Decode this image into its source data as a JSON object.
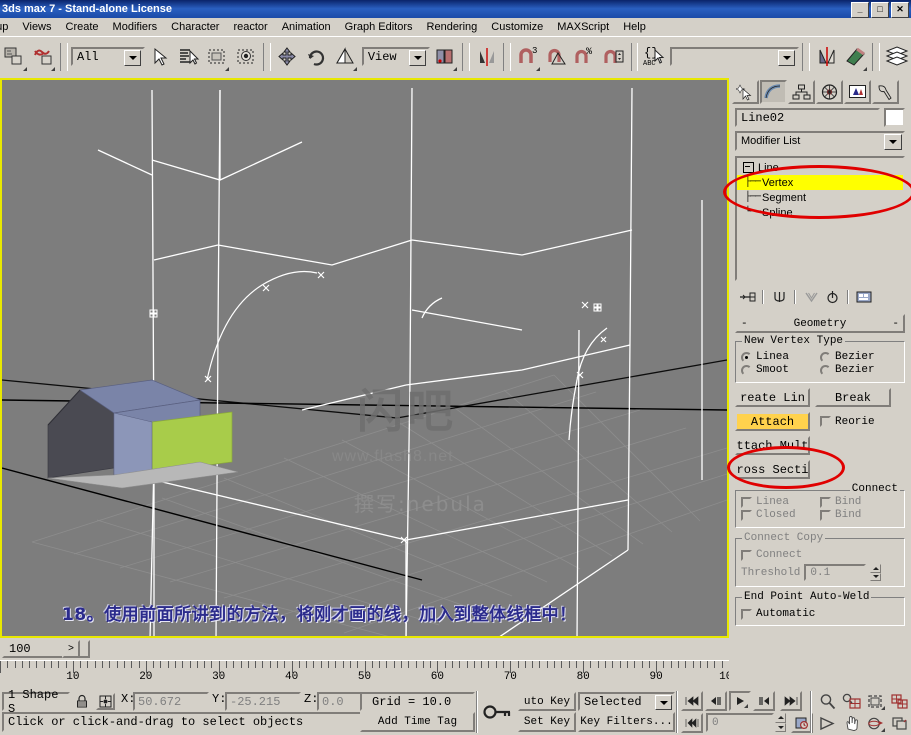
{
  "window": {
    "title": "3ds max 7  - Stand-alone License",
    "minimize": "_",
    "maximize": "□",
    "close": "✕"
  },
  "menu": {
    "items": [
      {
        "label": "oup"
      },
      {
        "label": "Views"
      },
      {
        "label": "Create"
      },
      {
        "label": "Modifiers"
      },
      {
        "label": "Character"
      },
      {
        "label": "reactor"
      },
      {
        "label": "Animation"
      },
      {
        "label": "Graph Editors"
      },
      {
        "label": "Rendering"
      },
      {
        "label": "Customize"
      },
      {
        "label": "MAXScript"
      },
      {
        "label": "Help"
      }
    ]
  },
  "toolbar": {
    "selection_filter": "All",
    "reference_coord": "View",
    "named_selection_set": "",
    "icons": [
      "undo-icon",
      "redo-icon",
      "select-link-icon",
      "unlink-icon",
      "bind-space-warp-icon",
      "select-object-icon",
      "select-by-name-icon",
      "rectangular-region-icon",
      "window-crossing-icon",
      "select-and-move-icon",
      "select-and-rotate-icon",
      "select-and-scale-icon",
      "use-pivot-center-icon",
      "mirror-icon",
      "align-icon",
      "layer-manager-icon",
      "snap-toggle-icon",
      "angle-snap-icon",
      "percent-snap-icon",
      "spinner-snap-icon",
      "named-selection-icon",
      "curve-editor-icon",
      "schematic-view-icon",
      "material-editor-icon",
      "render-scene-icon",
      "render-type-icon",
      "quick-render-icon"
    ]
  },
  "viewport": {
    "annotation": "18。使用前面所讲到的方法，将刚才画的线，加入到整体线框中！",
    "watermark_logo": "闪吧",
    "watermark_url": "www.flash8.net",
    "watermark_author": "撰写:nebula",
    "grid_color": "#8a8a8a",
    "background_color": "#7d7d7d",
    "border_color": "#e8e800"
  },
  "timeline": {
    "frame_field": "100",
    "next_arrow": ">",
    "tick_labels": [
      "10",
      "20",
      "30",
      "40",
      "50",
      "60",
      "70",
      "80",
      "90",
      "100"
    ]
  },
  "command_panel": {
    "tabs": [
      {
        "name": "create-tab",
        "icon": "star-arrow-icon",
        "selected": false
      },
      {
        "name": "modify-tab",
        "icon": "curve-icon",
        "selected": true
      },
      {
        "name": "hierarchy-tab",
        "icon": "hierarchy-icon",
        "selected": false
      },
      {
        "name": "motion-tab",
        "icon": "wheel-icon",
        "selected": false
      },
      {
        "name": "display-tab",
        "icon": "monitor-icon",
        "selected": false
      },
      {
        "name": "utilities-tab",
        "icon": "hammer-icon",
        "selected": false
      }
    ],
    "object_name": "Line02",
    "modifier_list_label": "Modifier List",
    "stack": [
      {
        "label": "Line",
        "type": "base",
        "selected": false
      },
      {
        "label": "Vertex",
        "type": "sub",
        "selected": true
      },
      {
        "label": "Segment",
        "type": "sub",
        "selected": false
      },
      {
        "label": "Spline",
        "type": "sub",
        "selected": false
      }
    ],
    "stack_tools": [
      "pin-stack-icon",
      "show-end-result-icon",
      "make-unique-icon",
      "remove-modifier-icon",
      "configure-sets-icon"
    ],
    "geometry_rollout": {
      "title": "Geometry",
      "collapse": "-",
      "new_vertex_type": {
        "title": "New Vertex Type",
        "options": [
          {
            "label": "Linea",
            "selected": true
          },
          {
            "label": "Bezier",
            "selected": false
          },
          {
            "label": "Smoot",
            "selected": false
          },
          {
            "label": "Bezier",
            "selected": false
          }
        ]
      },
      "create_line": "reate Lin",
      "break": "Break",
      "attach": "Attach",
      "reorient": "Reorie",
      "attach_mult": "ttach Mult",
      "cross_section": "ross Secti",
      "connect_label": "Connect",
      "connect_checks": [
        {
          "label": "Linea"
        },
        {
          "label": "Bind"
        },
        {
          "label": "Closed"
        },
        {
          "label": "Bind"
        }
      ],
      "connect_copy": {
        "title": "Connect Copy",
        "checkbox": "Connect",
        "threshold_label": "Threshold",
        "threshold_value": "0.1"
      },
      "auto_weld": {
        "title": "End Point Auto-Weld",
        "checkbox": "Automatic"
      }
    },
    "annotations": {
      "ellipse_color": "#e00000"
    }
  },
  "status_bar": {
    "selection_count": "1 Shape S",
    "lock_icon": "lock-selection-icon",
    "absolute_mode_icon": "absolute-relative-icon",
    "x_label": "X:",
    "x_value": "50.672",
    "y_label": "Y:",
    "y_value": "-25.215",
    "z_label": "Z:",
    "z_value": "0.0",
    "grid": "Grid = 10.0",
    "prompt": "Click or click-and-drag to select objects",
    "add_time_tag": "Add Time Tag",
    "auto_key": "uto Key",
    "set_key": "Set Key",
    "key_mode": "Selected",
    "key_filters": "Key Filters...",
    "key_icon": "key-icon",
    "frame_value": "0",
    "playback": [
      "goto-start-icon",
      "prev-frame-icon",
      "play-icon",
      "next-frame-icon",
      "goto-end-icon"
    ],
    "nav_icons": [
      "zoom-icon",
      "zoom-all-icon",
      "zoom-extents-icon",
      "zoom-extents-all-icon",
      "field-of-view-icon",
      "pan-icon",
      "arc-rotate-icon",
      "maximize-viewport-icon"
    ],
    "key_mode_toggle_icon": "key-mode-toggle-icon",
    "time_config_icon": "time-configuration-icon"
  }
}
